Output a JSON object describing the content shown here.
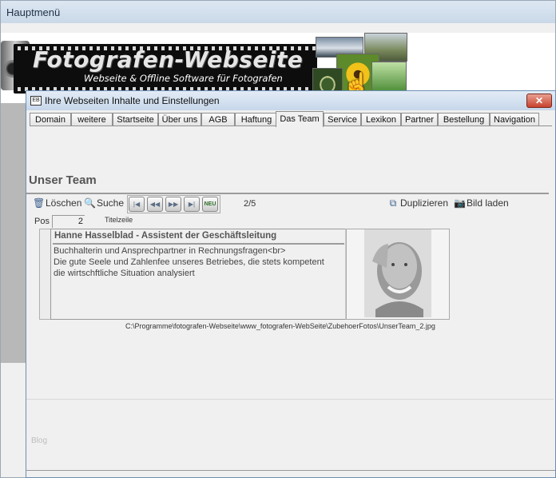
{
  "outer_window": {
    "title": "Hauptmenü"
  },
  "banner": {
    "title": "Fotografen-Webseite",
    "subtitle": "Webseite & Offline Software für Fotografen"
  },
  "dialog": {
    "title": "Ihre Webseiten Inhalte und Einstellungen",
    "close_label": "✕"
  },
  "tabs": [
    {
      "label": "Domain"
    },
    {
      "label": "weitere"
    },
    {
      "label": "Startseite"
    },
    {
      "label": "Über uns"
    },
    {
      "label": "AGB"
    },
    {
      "label": "Haftung"
    },
    {
      "label": "Das Team"
    },
    {
      "label": "Service"
    },
    {
      "label": "Lexikon"
    },
    {
      "label": "Partner"
    },
    {
      "label": "Bestellung"
    },
    {
      "label": "Navigation"
    }
  ],
  "active_tab": "Das Team",
  "section_title": "Unser Team",
  "toolbar": {
    "delete_label": "Löschen",
    "search_label": "Suche",
    "new_label": "NEU",
    "record_position": "2/5",
    "duplicate_label": "Duplizieren",
    "load_image_label": "Bild laden"
  },
  "record": {
    "pos_label": "Pos",
    "pos_value": "2",
    "title_label": "Titelzeile",
    "title_value": "Hanne Hasselblad - Assistent der Geschäftsleitung",
    "description": "Buchhalterin und Ansprechpartner in Rechnungsfragen<br>\nDie gute Seele und Zahlenfee unseres Betriebes, die stets kompetent\ndie wirtschftliche Situation analysiert",
    "image_path": "C:\\Programme\\fotografen-Webseite\\www_fotografen-WebSeite\\ZubehoerFotos\\UnserTeam_2.jpg"
  },
  "bottom_label": "Blog",
  "colors": {
    "accent": "#c8412e",
    "titlebar": "#c9d8e8"
  }
}
